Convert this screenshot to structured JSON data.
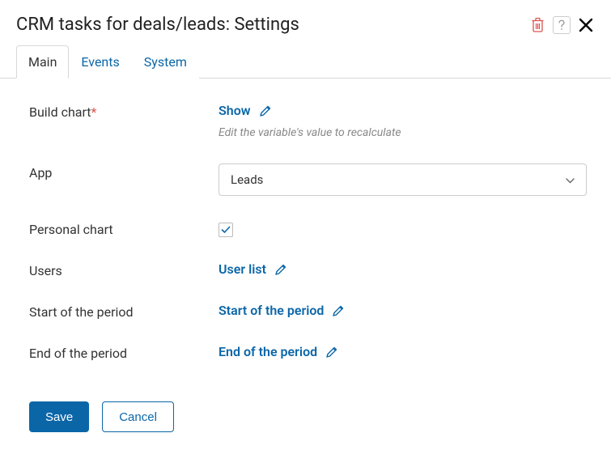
{
  "header": {
    "title": "CRM tasks for deals/leads: Settings"
  },
  "tabs": [
    {
      "label": "Main",
      "active": true
    },
    {
      "label": "Events",
      "active": false
    },
    {
      "label": "System",
      "active": false
    }
  ],
  "fields": {
    "build_chart": {
      "label": "Build chart",
      "value": "Show",
      "hint": "Edit the variable's value to recalculate",
      "required": true
    },
    "app": {
      "label": "App",
      "value": "Leads"
    },
    "personal_chart": {
      "label": "Personal chart",
      "checked": true
    },
    "users": {
      "label": "Users",
      "value": "User list"
    },
    "start_period": {
      "label": "Start of the period",
      "value": "Start of the period"
    },
    "end_period": {
      "label": "End of the period",
      "value": "End of the period"
    }
  },
  "buttons": {
    "save": "Save",
    "cancel": "Cancel"
  }
}
